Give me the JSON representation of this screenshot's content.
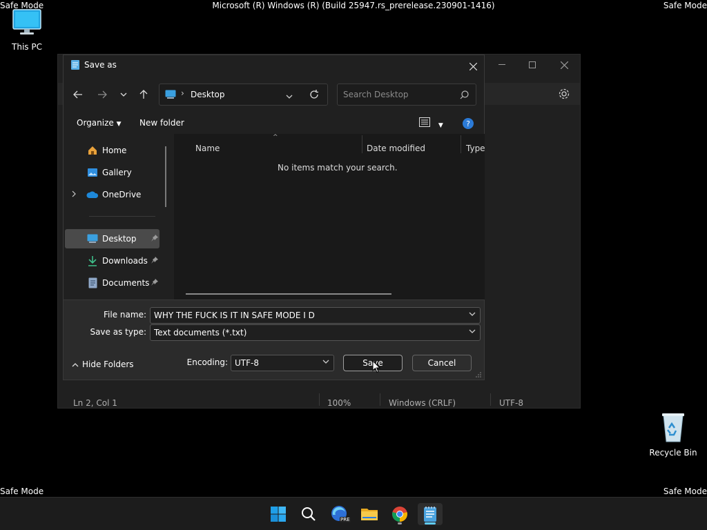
{
  "desktop": {
    "safe_mode": "Safe Mode",
    "build_text": "Microsoft (R) Windows (R) (Build 25947.rs_prerelease.230901-1416)",
    "icons": [
      {
        "label": "This PC",
        "icon": "monitor-icon"
      },
      {
        "label": "Recycle Bin",
        "icon": "recycle-bin-icon"
      }
    ]
  },
  "notepad": {
    "status": {
      "position": "Ln 2, Col 1",
      "zoom": "100%",
      "line_endings": "Windows (CRLF)",
      "encoding": "UTF-8"
    }
  },
  "dialog": {
    "title": "Save as",
    "address": "Desktop",
    "search_placeholder": "Search Desktop",
    "organize": "Organize",
    "new_folder": "New folder",
    "nav": [
      {
        "label": "Home",
        "icon": "home-icon"
      },
      {
        "label": "Gallery",
        "icon": "gallery-icon"
      },
      {
        "label": "OneDrive",
        "icon": "onedrive-icon"
      },
      {
        "label": "Desktop",
        "icon": "desktop-icon",
        "selected": true
      },
      {
        "label": "Downloads",
        "icon": "download-icon"
      },
      {
        "label": "Documents",
        "icon": "document-icon"
      }
    ],
    "columns": [
      "Name",
      "Date modified",
      "Type"
    ],
    "empty_message": "No items match your search.",
    "file_name_label": "File name:",
    "file_name_value": "WHY THE FUCK IS IT IN SAFE MODE I D",
    "save_type_label": "Save as type:",
    "save_type_value": "Text documents (*.txt)",
    "hide_folders": "Hide Folders",
    "encoding_label": "Encoding:",
    "encoding_value": "UTF-8",
    "save": "Save",
    "cancel": "Cancel"
  },
  "taskbar": {
    "items": [
      "start-icon",
      "search-icon",
      "edge-canary-icon",
      "file-explorer-icon",
      "chrome-icon",
      "notepad-icon"
    ],
    "badge": "PRE"
  },
  "colors": {
    "accent": "#60cdff",
    "folder": "#f0c13a"
  }
}
